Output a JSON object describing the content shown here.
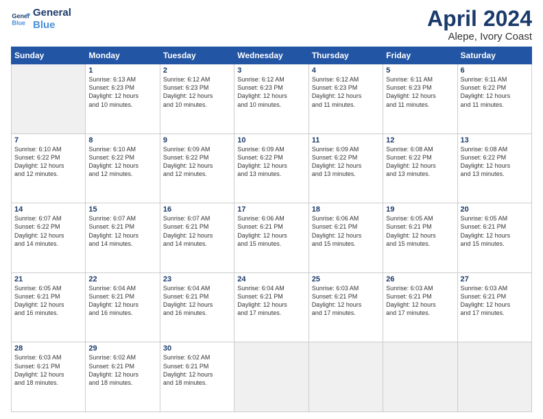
{
  "logo": {
    "line1": "General",
    "line2": "Blue"
  },
  "title": "April 2024",
  "subtitle": "Alepe, Ivory Coast",
  "headers": [
    "Sunday",
    "Monday",
    "Tuesday",
    "Wednesday",
    "Thursday",
    "Friday",
    "Saturday"
  ],
  "weeks": [
    [
      {
        "day": "",
        "info": ""
      },
      {
        "day": "1",
        "info": "Sunrise: 6:13 AM\nSunset: 6:23 PM\nDaylight: 12 hours\nand 10 minutes."
      },
      {
        "day": "2",
        "info": "Sunrise: 6:12 AM\nSunset: 6:23 PM\nDaylight: 12 hours\nand 10 minutes."
      },
      {
        "day": "3",
        "info": "Sunrise: 6:12 AM\nSunset: 6:23 PM\nDaylight: 12 hours\nand 10 minutes."
      },
      {
        "day": "4",
        "info": "Sunrise: 6:12 AM\nSunset: 6:23 PM\nDaylight: 12 hours\nand 11 minutes."
      },
      {
        "day": "5",
        "info": "Sunrise: 6:11 AM\nSunset: 6:23 PM\nDaylight: 12 hours\nand 11 minutes."
      },
      {
        "day": "6",
        "info": "Sunrise: 6:11 AM\nSunset: 6:22 PM\nDaylight: 12 hours\nand 11 minutes."
      }
    ],
    [
      {
        "day": "7",
        "info": "Sunrise: 6:10 AM\nSunset: 6:22 PM\nDaylight: 12 hours\nand 12 minutes."
      },
      {
        "day": "8",
        "info": "Sunrise: 6:10 AM\nSunset: 6:22 PM\nDaylight: 12 hours\nand 12 minutes."
      },
      {
        "day": "9",
        "info": "Sunrise: 6:09 AM\nSunset: 6:22 PM\nDaylight: 12 hours\nand 12 minutes."
      },
      {
        "day": "10",
        "info": "Sunrise: 6:09 AM\nSunset: 6:22 PM\nDaylight: 12 hours\nand 13 minutes."
      },
      {
        "day": "11",
        "info": "Sunrise: 6:09 AM\nSunset: 6:22 PM\nDaylight: 12 hours\nand 13 minutes."
      },
      {
        "day": "12",
        "info": "Sunrise: 6:08 AM\nSunset: 6:22 PM\nDaylight: 12 hours\nand 13 minutes."
      },
      {
        "day": "13",
        "info": "Sunrise: 6:08 AM\nSunset: 6:22 PM\nDaylight: 12 hours\nand 13 minutes."
      }
    ],
    [
      {
        "day": "14",
        "info": "Sunrise: 6:07 AM\nSunset: 6:22 PM\nDaylight: 12 hours\nand 14 minutes."
      },
      {
        "day": "15",
        "info": "Sunrise: 6:07 AM\nSunset: 6:21 PM\nDaylight: 12 hours\nand 14 minutes."
      },
      {
        "day": "16",
        "info": "Sunrise: 6:07 AM\nSunset: 6:21 PM\nDaylight: 12 hours\nand 14 minutes."
      },
      {
        "day": "17",
        "info": "Sunrise: 6:06 AM\nSunset: 6:21 PM\nDaylight: 12 hours\nand 15 minutes."
      },
      {
        "day": "18",
        "info": "Sunrise: 6:06 AM\nSunset: 6:21 PM\nDaylight: 12 hours\nand 15 minutes."
      },
      {
        "day": "19",
        "info": "Sunrise: 6:05 AM\nSunset: 6:21 PM\nDaylight: 12 hours\nand 15 minutes."
      },
      {
        "day": "20",
        "info": "Sunrise: 6:05 AM\nSunset: 6:21 PM\nDaylight: 12 hours\nand 15 minutes."
      }
    ],
    [
      {
        "day": "21",
        "info": "Sunrise: 6:05 AM\nSunset: 6:21 PM\nDaylight: 12 hours\nand 16 minutes."
      },
      {
        "day": "22",
        "info": "Sunrise: 6:04 AM\nSunset: 6:21 PM\nDaylight: 12 hours\nand 16 minutes."
      },
      {
        "day": "23",
        "info": "Sunrise: 6:04 AM\nSunset: 6:21 PM\nDaylight: 12 hours\nand 16 minutes."
      },
      {
        "day": "24",
        "info": "Sunrise: 6:04 AM\nSunset: 6:21 PM\nDaylight: 12 hours\nand 17 minutes."
      },
      {
        "day": "25",
        "info": "Sunrise: 6:03 AM\nSunset: 6:21 PM\nDaylight: 12 hours\nand 17 minutes."
      },
      {
        "day": "26",
        "info": "Sunrise: 6:03 AM\nSunset: 6:21 PM\nDaylight: 12 hours\nand 17 minutes."
      },
      {
        "day": "27",
        "info": "Sunrise: 6:03 AM\nSunset: 6:21 PM\nDaylight: 12 hours\nand 17 minutes."
      }
    ],
    [
      {
        "day": "28",
        "info": "Sunrise: 6:03 AM\nSunset: 6:21 PM\nDaylight: 12 hours\nand 18 minutes."
      },
      {
        "day": "29",
        "info": "Sunrise: 6:02 AM\nSunset: 6:21 PM\nDaylight: 12 hours\nand 18 minutes."
      },
      {
        "day": "30",
        "info": "Sunrise: 6:02 AM\nSunset: 6:21 PM\nDaylight: 12 hours\nand 18 minutes."
      },
      {
        "day": "",
        "info": ""
      },
      {
        "day": "",
        "info": ""
      },
      {
        "day": "",
        "info": ""
      },
      {
        "day": "",
        "info": ""
      }
    ]
  ]
}
